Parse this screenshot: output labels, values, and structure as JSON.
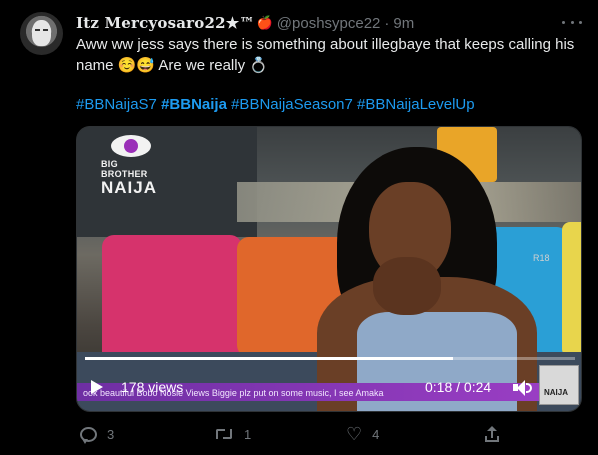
{
  "tweet": {
    "display_name": "Itz Mercyosaro22★™",
    "name_emoji": "🍎",
    "handle": "@poshsypce22",
    "separator": "·",
    "time": "9m",
    "text": "Aww ww jess says there is something about illegbaye that keeps calling his name ☺️😅 Are we really 💍",
    "hashtags": [
      {
        "text": "#BBNaijaS7",
        "bold": false
      },
      {
        "text": "#BBNaija",
        "bold": true
      },
      {
        "text": "#BBNaijaSeason7",
        "bold": false
      },
      {
        "text": "#BBNaijaLevelUp",
        "bold": false
      }
    ]
  },
  "media": {
    "logo_line1": "BIG BROTHER",
    "logo_line2": "NAIJA",
    "rating": "R18",
    "ticker": "ook beautiful  Bobo   Nosie Views  Biggie plz put on some music, I see Amaka",
    "corner_logo": "NAIJA",
    "views": "178 views",
    "timecode": "0:18 / 0:24",
    "progress_fraction": 0.75
  },
  "actions": {
    "reply_count": "3",
    "retweet_count": "1",
    "like_count": "4",
    "like_glyph": "♡"
  },
  "colors": {
    "background": "#000000",
    "text": "#e7e9ea",
    "muted": "#71767b",
    "link": "#1d9bf0"
  }
}
